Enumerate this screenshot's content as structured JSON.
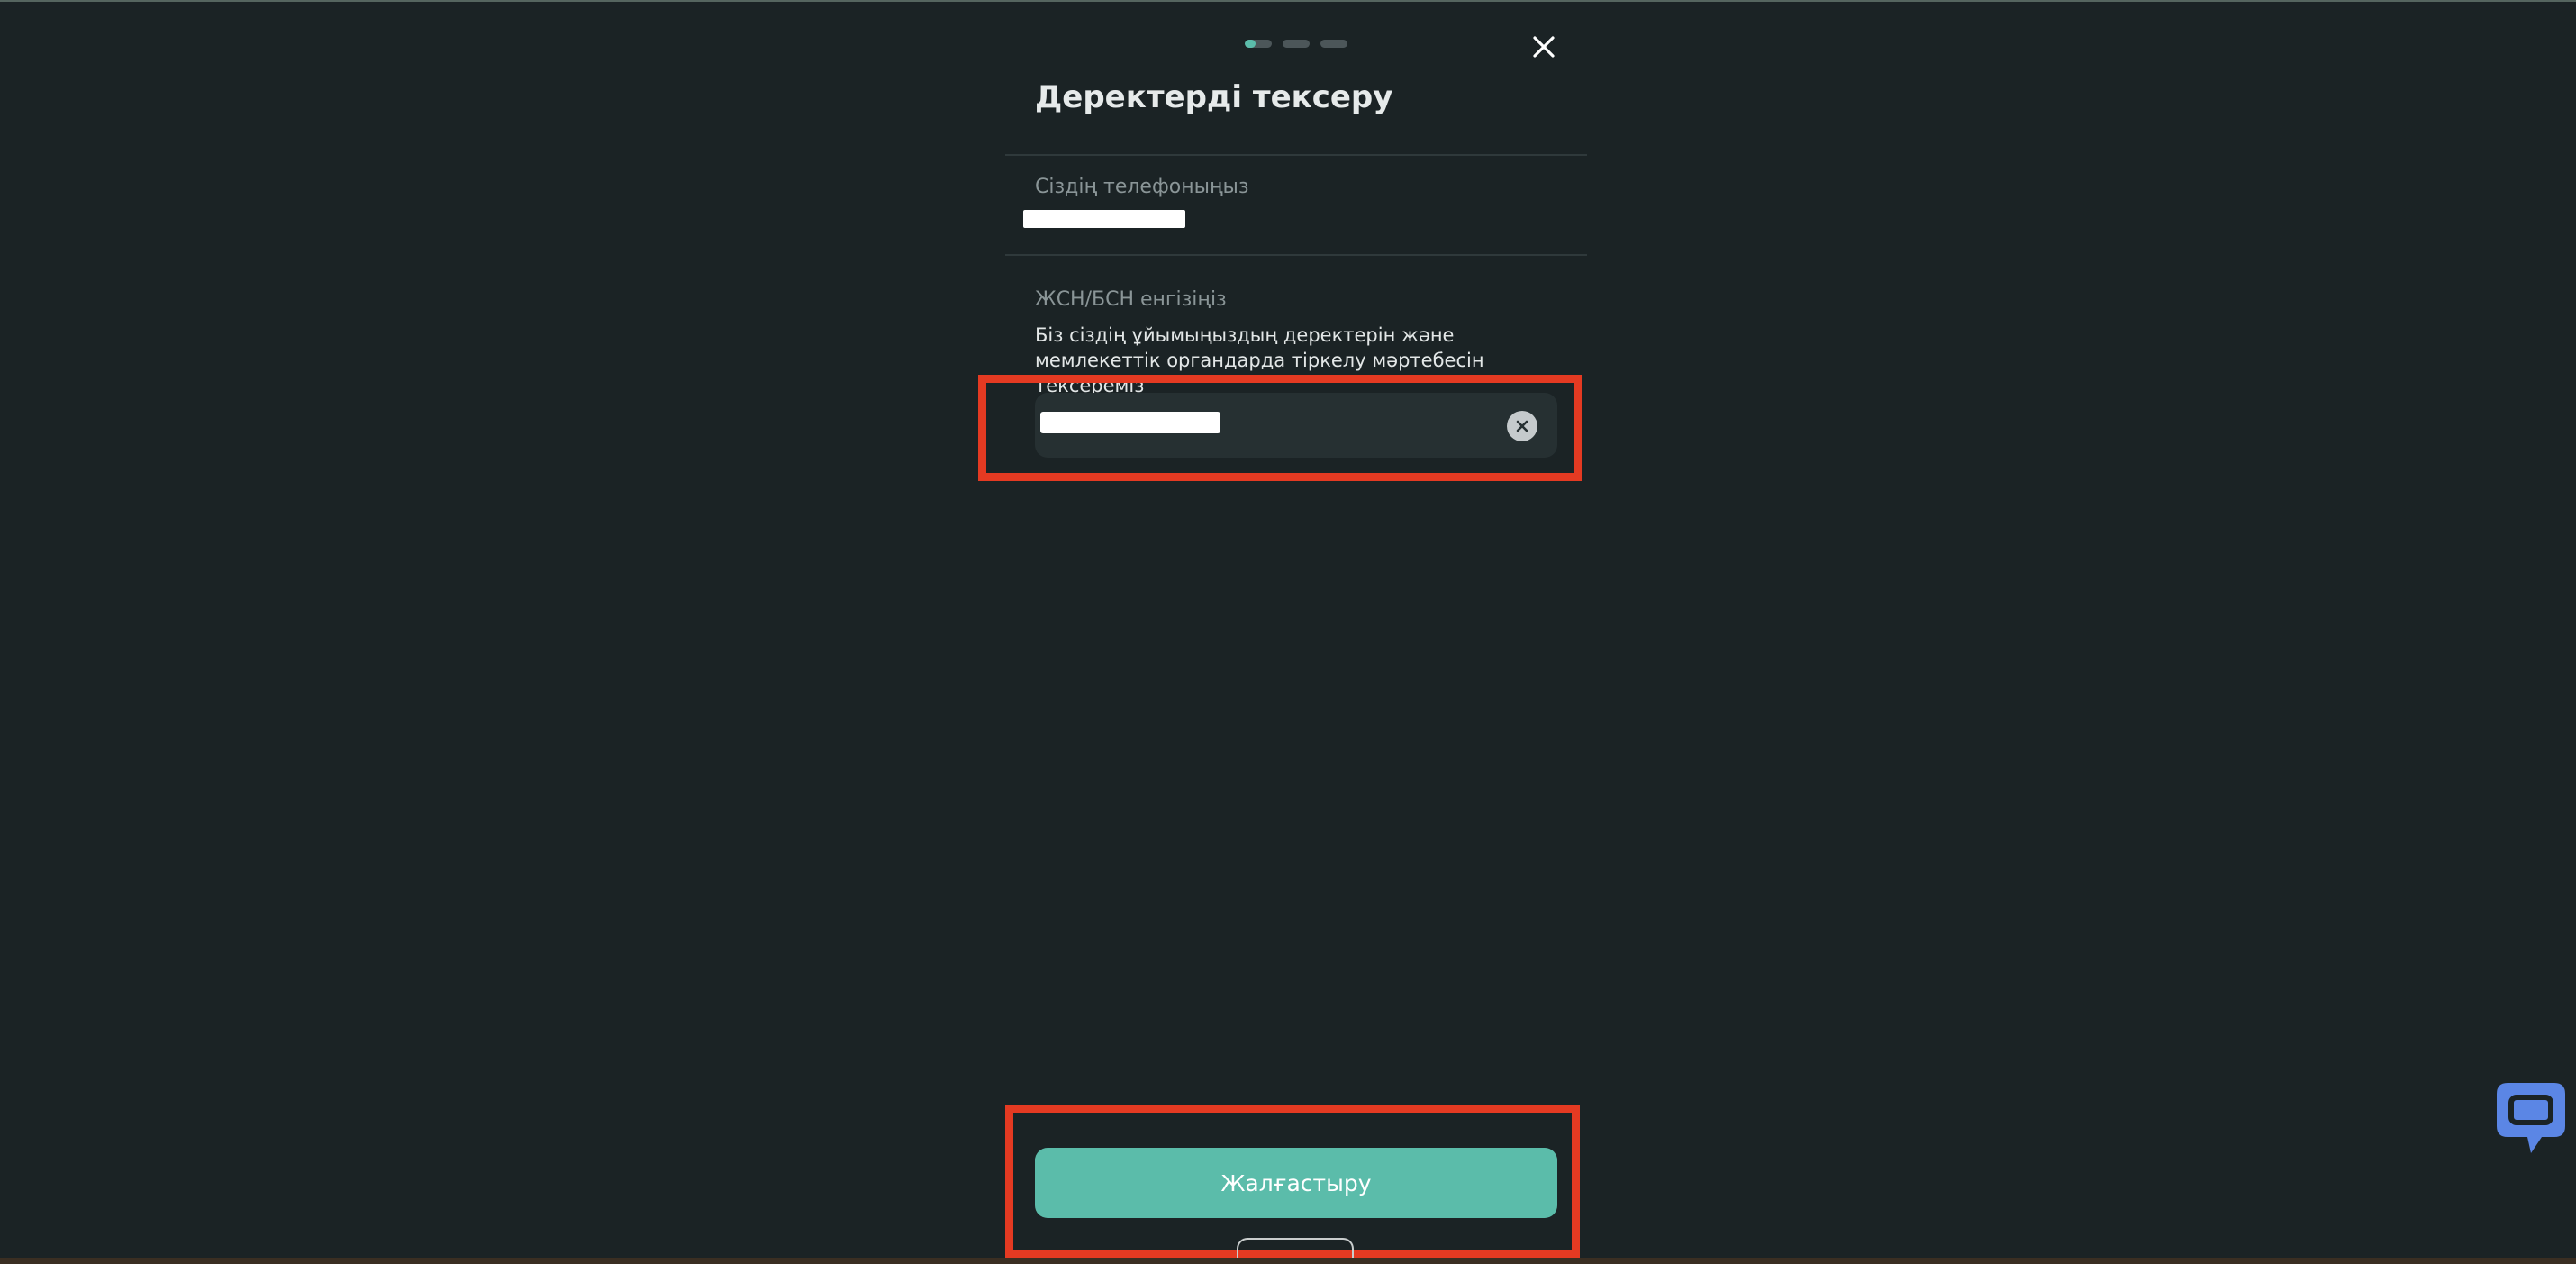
{
  "stepper": {
    "steps": [
      {
        "progress": 0.4
      },
      {
        "progress": 0
      },
      {
        "progress": 0
      }
    ]
  },
  "header": {
    "title": "Деректерді тексеру",
    "close_icon": "close-icon"
  },
  "phone": {
    "label": "Сіздің телефоныңыз"
  },
  "iin": {
    "label": "ЖСН/БСН енгізіңіз",
    "help": "Біз сіздің ұйымыңыздың деректерін және мемлекеттік органдарда тіркелу мәртебесін тексереміз",
    "clear_icon": "clear-circle-icon"
  },
  "footer": {
    "continue_label": "Жалғастыру"
  },
  "chat": {
    "icon": "chat-icon"
  },
  "colors": {
    "background": "#1b2325",
    "accent": "#5bbcaa",
    "highlight": "#e43a22",
    "chat": "#5b86e5"
  }
}
